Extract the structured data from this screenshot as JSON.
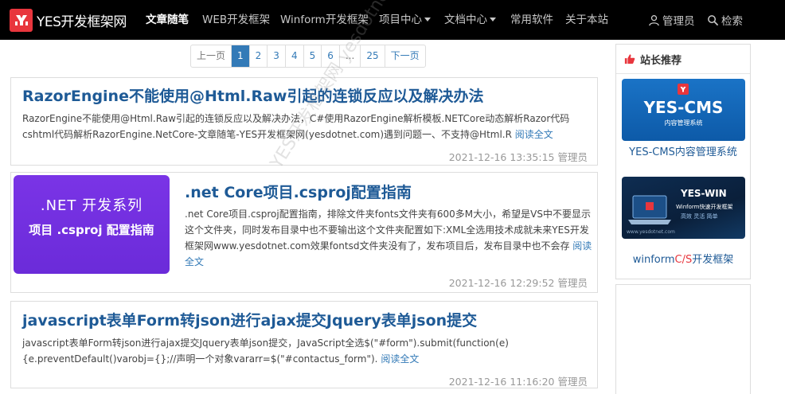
{
  "navbar": {
    "brand": "YES开发框架网",
    "items": [
      {
        "label": "文章随笔",
        "active": true
      },
      {
        "label": "WEB开发框架"
      },
      {
        "label": "Winform开发框架"
      },
      {
        "label": "项目中心",
        "dropdown": true
      },
      {
        "label": "文档中心",
        "dropdown": true
      },
      {
        "label": "常用软件"
      },
      {
        "label": "关于本站"
      }
    ],
    "user_label": "管理员",
    "search_label": "检索"
  },
  "pagination": {
    "prev": "上一页",
    "pages": [
      "1",
      "2",
      "3",
      "4",
      "5",
      "6",
      "...",
      "25"
    ],
    "current": "1",
    "next": "下一页"
  },
  "articles": [
    {
      "title": "RazorEngine不能使用@Html.Raw引起的连锁反应以及解决办法",
      "excerpt": "RazorEngine不能使用@Html.Raw引起的连锁反应以及解决办法，C#使用RazorEngine解析模板.NETCore动态解析Razor代码cshtml代码解析RazorEngine.NetCore-文章随笔-YES开发框架网(yesdotnet.com)遇到问题一、不支持@Html.R",
      "more": "阅读全文",
      "date": "2021-12-16 13:35:15",
      "author": "管理员"
    },
    {
      "title": ".net Core项目.csproj配置指南",
      "thumb_line1": ".NET 开发系列",
      "thumb_line2": "项目 .csproj 配置指南",
      "excerpt": ".net Core项目.csproj配置指南，排除文件夹fonts文件夹有600多M大小，希望是VS中不要显示这个文件夹，同时发布目录中也不要输出这个文件夹配置如下:XML全选用技术成就未来YES开发框架网www.yesdotnet.com效果fontsd文件夹没有了，发布项目后，发布目录中也不会存",
      "more": "阅读全文",
      "date": "2021-12-16 12:29:52",
      "author": "管理员"
    },
    {
      "title": "javascript表单Form转json进行ajax提交Jquery表单json提交",
      "excerpt": "javascript表单Form转json进行ajax提交Jquery表单json提交，JavaScript全选$(\"#form\").submit(function(e){e.preventDefault()varobj={};//声明一个对象vararr=$(\"#contactus_form\").",
      "more": "阅读全文",
      "date": "2021-12-16 11:16:20",
      "author": "管理员"
    }
  ],
  "sidebar": {
    "title": "站长推荐",
    "ad1": {
      "title": "YES-CMS",
      "subtitle": "内容管理系统",
      "caption": "YES-CMS内容管理系统"
    },
    "ad2": {
      "title": "YES-WIN",
      "subtitle": "Winform快速开发框架",
      "tags": "高效  灵活  简单",
      "url": "www.yesdotnet.com",
      "caption_a": "winform",
      "caption_b": "C/S",
      "caption_c": "开发框架"
    }
  },
  "watermark": "YES开发框架网 yesdotnet.com",
  "colors": {
    "navbar": "#000000",
    "accent": "#337ab7",
    "title": "#1e5a96",
    "brand_red": "#e8363d",
    "thumb_purple": "#7a34e6"
  }
}
